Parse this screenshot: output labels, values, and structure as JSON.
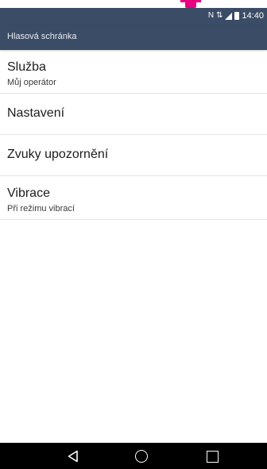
{
  "status_bar": {
    "time": "14:40",
    "icons": [
      "nfc-icon",
      "data-icon",
      "signal-icon",
      "battery-icon"
    ]
  },
  "app_bar": {
    "title": "Hlasová schránka"
  },
  "settings": [
    {
      "title": "Služba",
      "subtitle": "Můj operátor"
    },
    {
      "title": "Nastavení"
    },
    {
      "title": "Zvuky upozornění"
    },
    {
      "title": "Vibrace",
      "subtitle": "Při režimu vibrací"
    }
  ],
  "nav_bar": {
    "buttons": [
      "back-icon",
      "home-icon",
      "recent-apps-icon"
    ]
  },
  "colors": {
    "app_bar": "#3b4c66",
    "accent": "#e6007e",
    "nav_bar": "#000000"
  }
}
